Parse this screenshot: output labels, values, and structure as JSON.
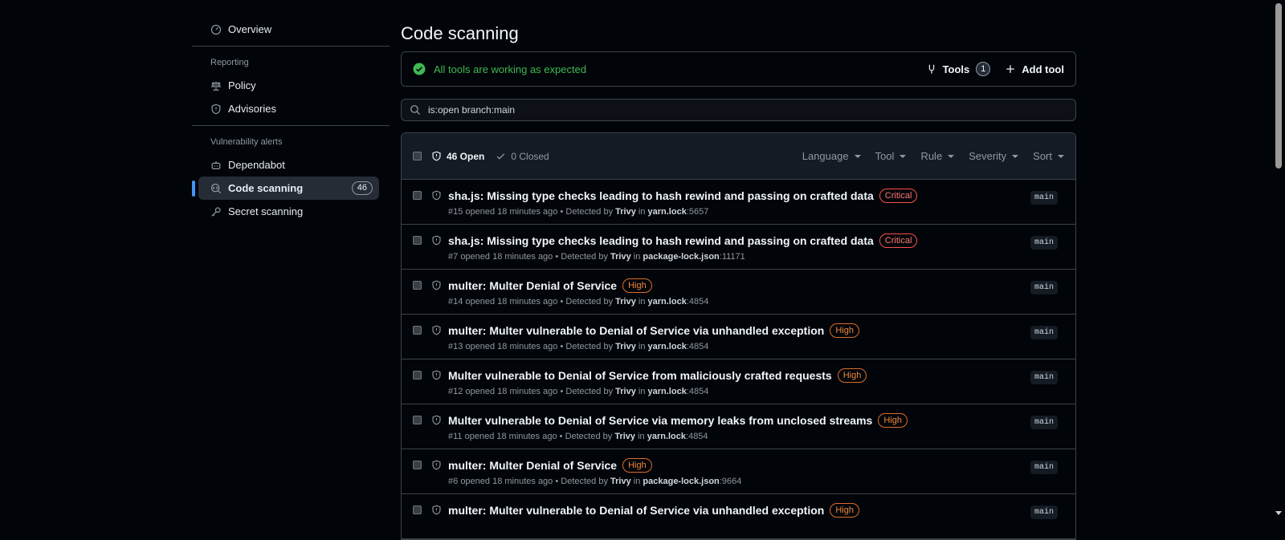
{
  "sidebar": {
    "overview": "Overview",
    "reporting_title": "Reporting",
    "policy": "Policy",
    "advisories": "Advisories",
    "vuln_title": "Vulnerability alerts",
    "dependabot": "Dependabot",
    "code_scanning": "Code scanning",
    "code_scanning_count": "46",
    "secret_scanning": "Secret scanning"
  },
  "main": {
    "title": "Code scanning",
    "status": "All tools are working as expected",
    "tools_label": "Tools",
    "tools_count": "1",
    "add_tool": "Add tool",
    "search_value": "is:open branch:main",
    "open_label": "46 Open",
    "closed_label": "0 Closed",
    "filters": [
      "Language",
      "Tool",
      "Rule",
      "Severity",
      "Sort"
    ]
  },
  "alerts": [
    {
      "title": "sha.js: Missing type checks leading to hash rewind and passing on crafted data",
      "severity": "Critical",
      "id": "#15",
      "opened": "opened 18 minutes ago",
      "detected": "• Detected by",
      "tool": "Trivy",
      "in": "in",
      "file": "yarn.lock",
      "line": ":5657",
      "branch": "main"
    },
    {
      "title": "sha.js: Missing type checks leading to hash rewind and passing on crafted data",
      "severity": "Critical",
      "id": "#7",
      "opened": "opened 18 minutes ago",
      "detected": "• Detected by",
      "tool": "Trivy",
      "in": "in",
      "file": "package-lock.json",
      "line": ":11171",
      "branch": "main"
    },
    {
      "title": "multer: Multer Denial of Service",
      "severity": "High",
      "id": "#14",
      "opened": "opened 18 minutes ago",
      "detected": "• Detected by",
      "tool": "Trivy",
      "in": "in",
      "file": "yarn.lock",
      "line": ":4854",
      "branch": "main"
    },
    {
      "title": "multer: Multer vulnerable to Denial of Service via unhandled exception",
      "severity": "High",
      "id": "#13",
      "opened": "opened 18 minutes ago",
      "detected": "• Detected by",
      "tool": "Trivy",
      "in": "in",
      "file": "yarn.lock",
      "line": ":4854",
      "branch": "main"
    },
    {
      "title": "Multer vulnerable to Denial of Service from maliciously crafted requests",
      "severity": "High",
      "id": "#12",
      "opened": "opened 18 minutes ago",
      "detected": "• Detected by",
      "tool": "Trivy",
      "in": "in",
      "file": "yarn.lock",
      "line": ":4854",
      "branch": "main"
    },
    {
      "title": "Multer vulnerable to Denial of Service via memory leaks from unclosed streams",
      "severity": "High",
      "id": "#11",
      "opened": "opened 18 minutes ago",
      "detected": "• Detected by",
      "tool": "Trivy",
      "in": "in",
      "file": "yarn.lock",
      "line": ":4854",
      "branch": "main"
    },
    {
      "title": "multer: Multer Denial of Service",
      "severity": "High",
      "id": "#6",
      "opened": "opened 18 minutes ago",
      "detected": "• Detected by",
      "tool": "Trivy",
      "in": "in",
      "file": "package-lock.json",
      "line": ":9664",
      "branch": "main"
    },
    {
      "title": "multer: Multer vulnerable to Denial of Service via unhandled exception",
      "severity": "High",
      "id": "",
      "opened": "",
      "detected": "",
      "tool": "",
      "in": "",
      "file": "",
      "line": "",
      "branch": "main"
    }
  ],
  "colors": {
    "accent": "#4493f8",
    "success": "#3fb950",
    "critical": "#ff7b72",
    "high": "#f0883e"
  }
}
